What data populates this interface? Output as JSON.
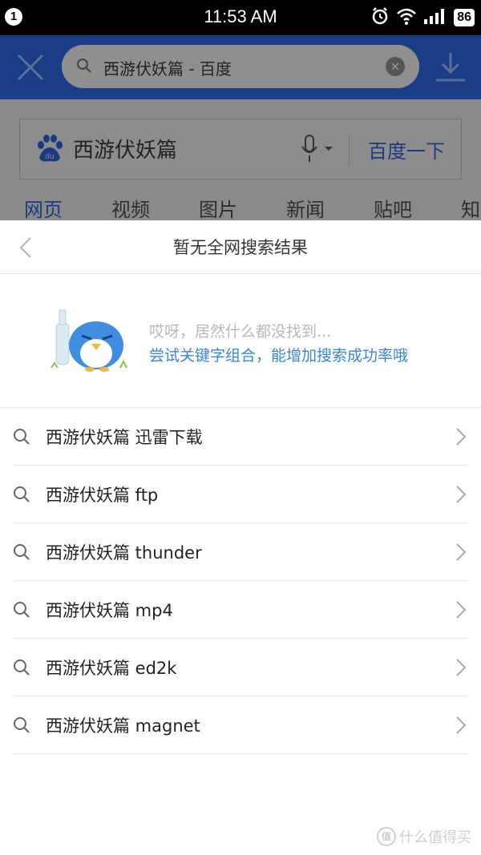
{
  "status_bar": {
    "notification_count": "1",
    "time": "11:53 AM",
    "battery": "86",
    "icons": [
      "alarm-icon",
      "wifi-icon",
      "signal-icon",
      "battery-icon"
    ]
  },
  "header": {
    "search_text": "西游伏妖篇 - 百度",
    "close_icon": "close-icon",
    "download_icon": "download-icon"
  },
  "page": {
    "query": "西游伏妖篇",
    "search_button": "百度一下",
    "tabs": [
      {
        "label": "网页"
      },
      {
        "label": "视频"
      },
      {
        "label": "图片"
      },
      {
        "label": "新闻"
      },
      {
        "label": "贴吧"
      },
      {
        "label": "知"
      }
    ]
  },
  "sheet": {
    "title": "暂无全网搜索结果",
    "empty_line1": "哎呀，居然什么都没找到...",
    "empty_line2": "尝试关键字组合，能增加搜索成功率哦",
    "suggestions": [
      {
        "label": "西游伏妖篇 迅雷下载"
      },
      {
        "label": "西游伏妖篇 ftp"
      },
      {
        "label": "西游伏妖篇 thunder"
      },
      {
        "label": "西游伏妖篇 mp4"
      },
      {
        "label": "西游伏妖篇 ed2k"
      },
      {
        "label": "西游伏妖篇 magnet"
      }
    ]
  },
  "watermark": {
    "badge": "值",
    "text": "什么值得买"
  },
  "colors": {
    "accent_blue": "#3a86d6",
    "header_dim": "#1b3d85"
  }
}
